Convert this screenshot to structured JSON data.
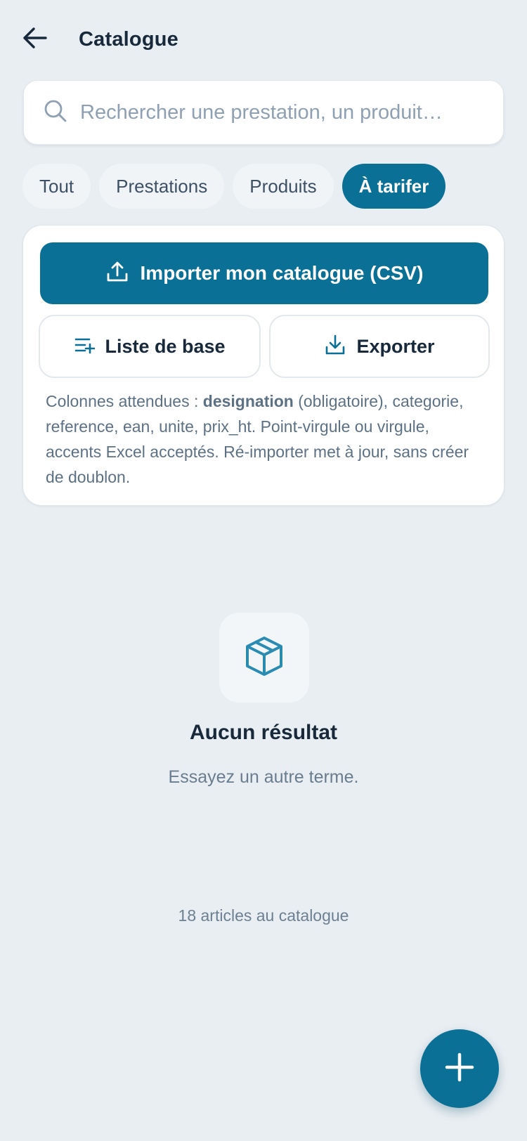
{
  "header": {
    "back_icon": "arrow-left-icon",
    "title": "Catalogue"
  },
  "search": {
    "icon": "search-icon",
    "placeholder": "Rechercher une prestation, un produit…",
    "value": ""
  },
  "filters": {
    "items": [
      {
        "label": "Tout",
        "active": false
      },
      {
        "label": "Prestations",
        "active": false
      },
      {
        "label": "Produits",
        "active": false
      },
      {
        "label": "À tarifer",
        "active": true
      }
    ]
  },
  "import_card": {
    "import_button": {
      "icon": "upload-icon",
      "label": "Importer mon catalogue (CSV)"
    },
    "base_list_button": {
      "icon": "list-add-icon",
      "label": "Liste de base"
    },
    "export_button": {
      "icon": "download-icon",
      "label": "Exporter"
    },
    "help": {
      "prefix": "Colonnes attendues : ",
      "bold": "designation",
      "suffix": " (obligatoire), categorie, reference, ean, unite, prix_ht. Point-virgule ou virgule, accents Excel acceptés. Ré-importer met à jour, sans créer de doublon."
    }
  },
  "empty_state": {
    "icon": "package-icon",
    "title": "Aucun résultat",
    "subtitle": "Essayez un autre terme."
  },
  "footer": {
    "count_text": "18 articles au catalogue"
  },
  "fab": {
    "icon": "plus-icon"
  },
  "colors": {
    "accent": "#0b7096",
    "background": "#e9eef2",
    "card": "#ffffff",
    "text_primary": "#17293a",
    "text_muted": "#6a7d8f"
  }
}
